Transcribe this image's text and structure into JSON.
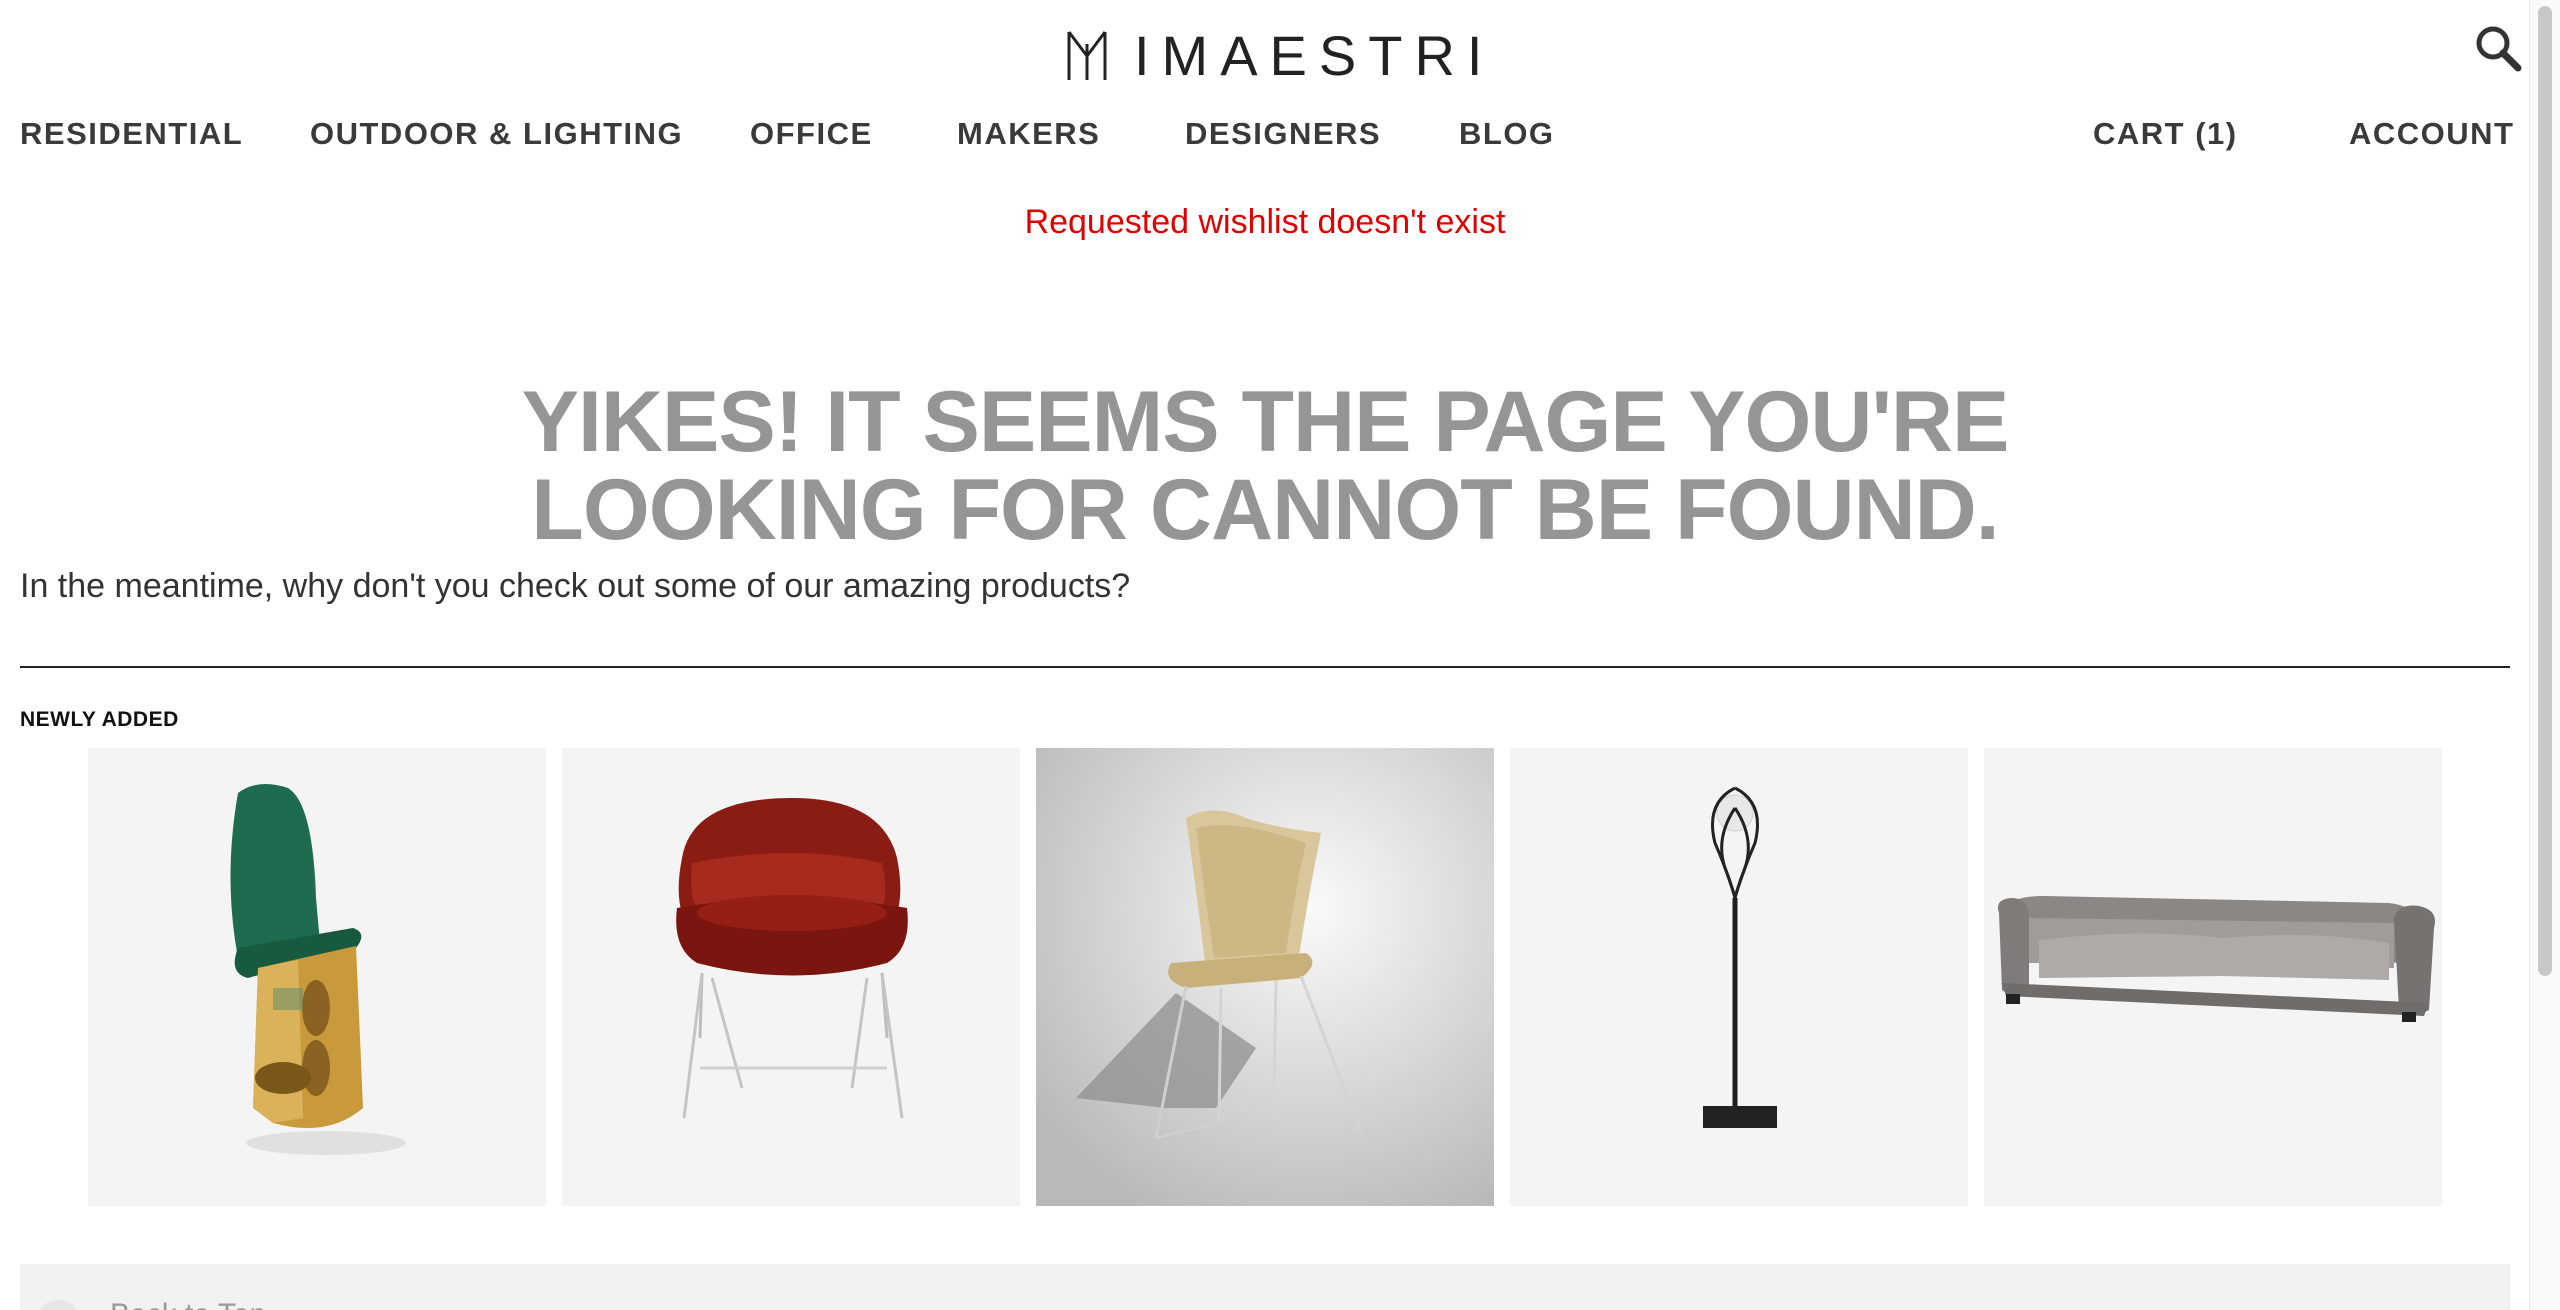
{
  "brand": {
    "name": "IMAESTRI"
  },
  "nav": {
    "items": [
      {
        "label": "RESIDENTIAL"
      },
      {
        "label": "OUTDOOR & LIGHTING"
      },
      {
        "label": "OFFICE"
      },
      {
        "label": "MAKERS"
      },
      {
        "label": "DESIGNERS"
      },
      {
        "label": "BLOG"
      }
    ],
    "cart_label": "CART (1)",
    "account_label": "ACCOUNT"
  },
  "icons": {
    "search": "search-icon"
  },
  "alert": {
    "message": "Requested wishlist doesn't exist",
    "color": "#e00000"
  },
  "main": {
    "headline_line1": "YIKES! IT SEEMS THE PAGE YOU'RE",
    "headline_line2": "LOOKING FOR CANNOT BE FOUND.",
    "subtext": "In the meantime, why don't you check out some of our amazing products?",
    "section_title": "NEWLY ADDED"
  },
  "products": [
    {
      "icon": "green-velvet-chair-image"
    },
    {
      "icon": "red-velvet-armchair-image"
    },
    {
      "icon": "wicker-chair-image"
    },
    {
      "icon": "floor-lamp-image"
    },
    {
      "icon": "grey-sofa-image"
    }
  ],
  "footer_bar": {
    "text": "Back to Top"
  }
}
